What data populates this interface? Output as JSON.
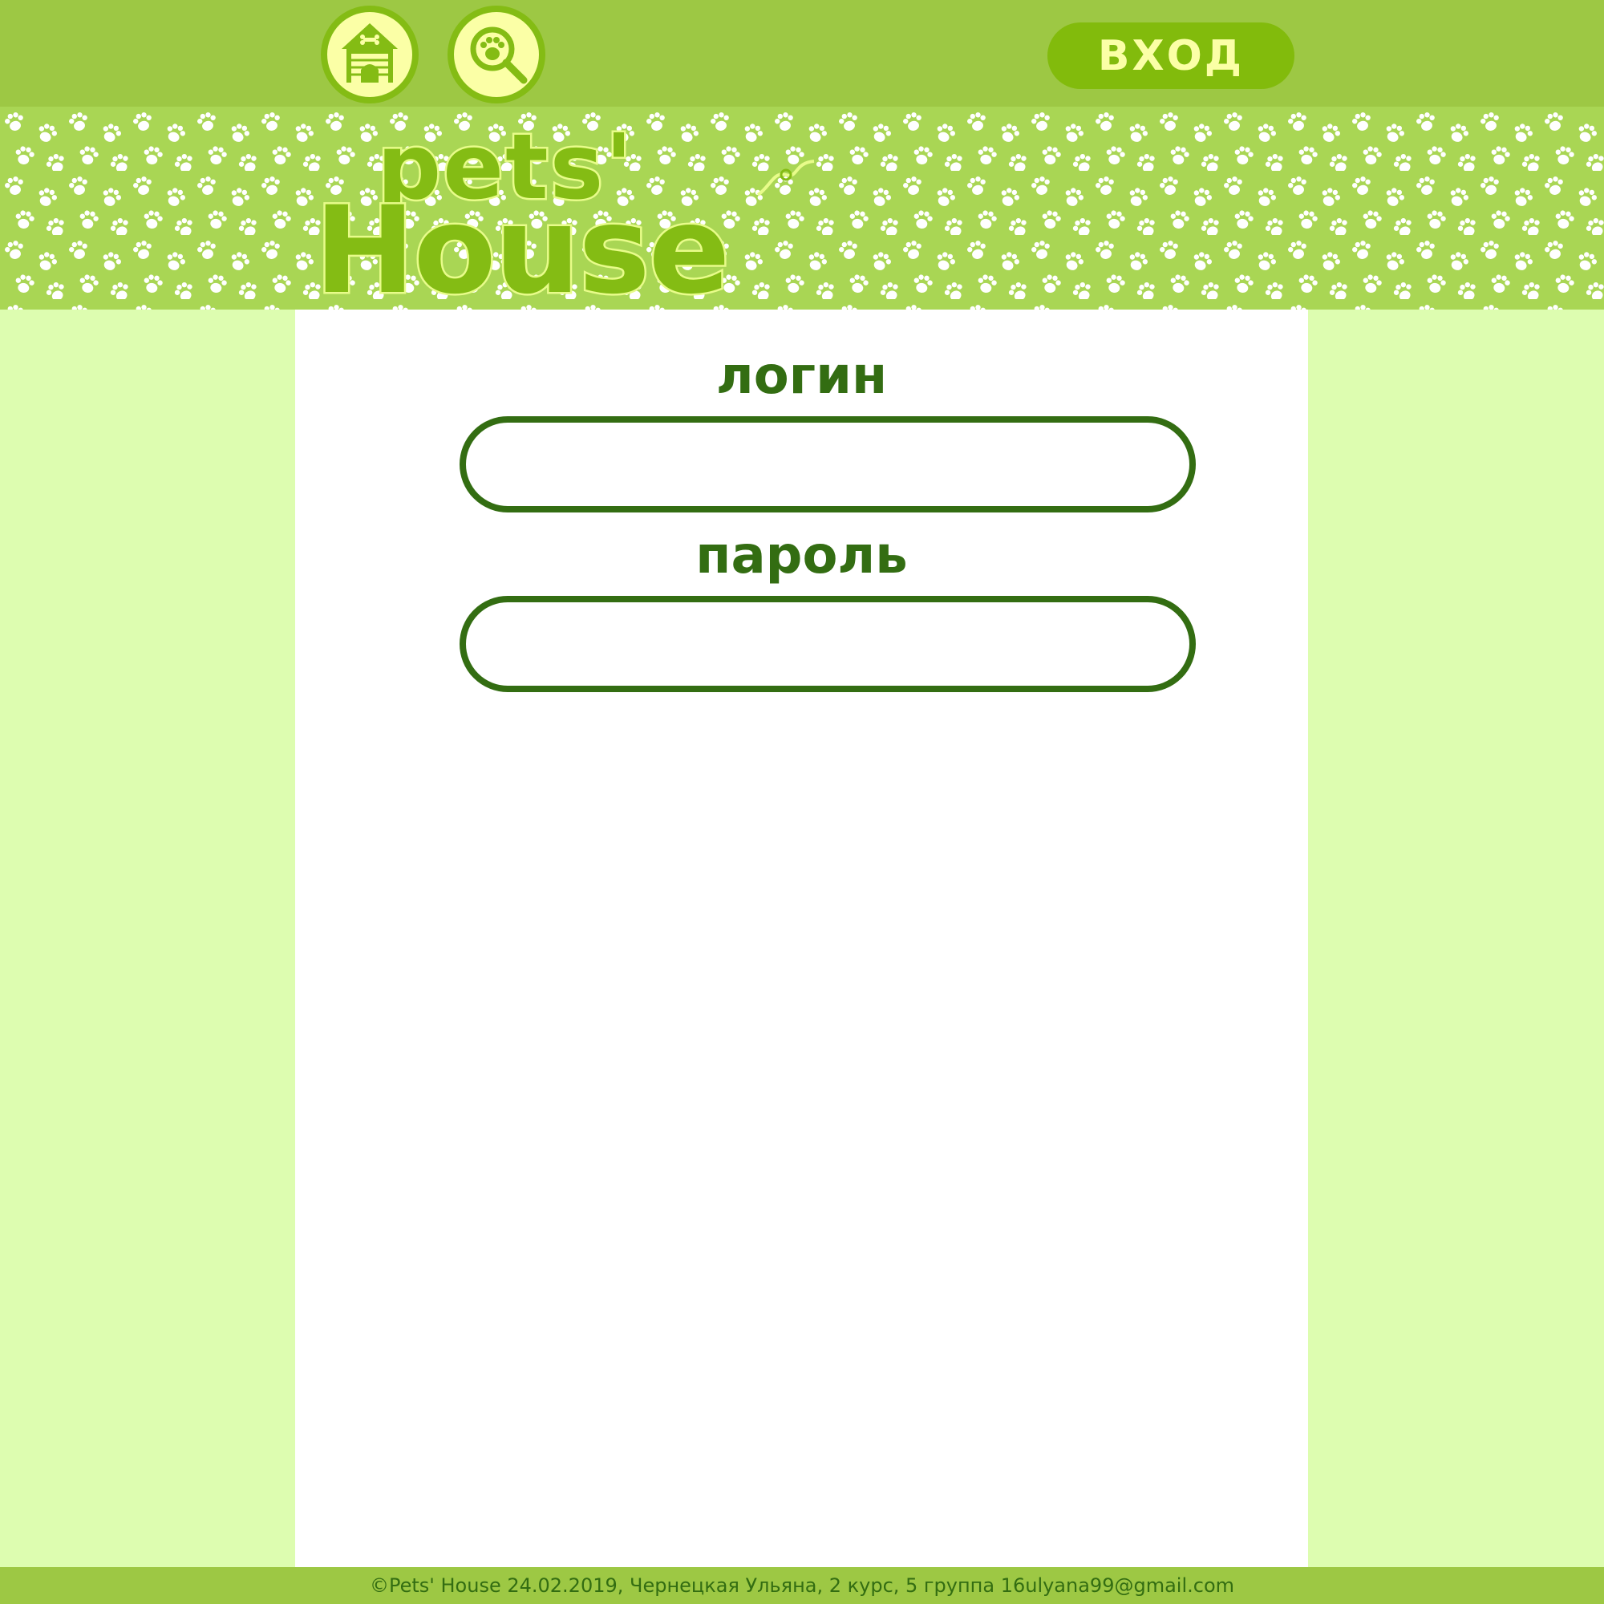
{
  "header": {
    "nav": [
      {
        "icon": "doghouse-icon"
      },
      {
        "icon": "paw-search-icon"
      }
    ],
    "login_button_label": "ВХОД"
  },
  "banner": {
    "logo_line1": "pets'",
    "logo_line2": "House"
  },
  "form": {
    "login_label": "логин",
    "login_value": "",
    "password_label": "пароль",
    "password_value": ""
  },
  "footer": {
    "text": "©Pets' House 24.02.2019, Чернецкая Ульяна, 2 курс, 5 группа 16ulyana99@gmail.com"
  },
  "colors": {
    "header_bg": "#9dc844",
    "accent_green": "#82bb0c",
    "dark_green": "#336d12",
    "pale_yellow": "#fbffa6",
    "side_bg": "#ddfdb0"
  }
}
